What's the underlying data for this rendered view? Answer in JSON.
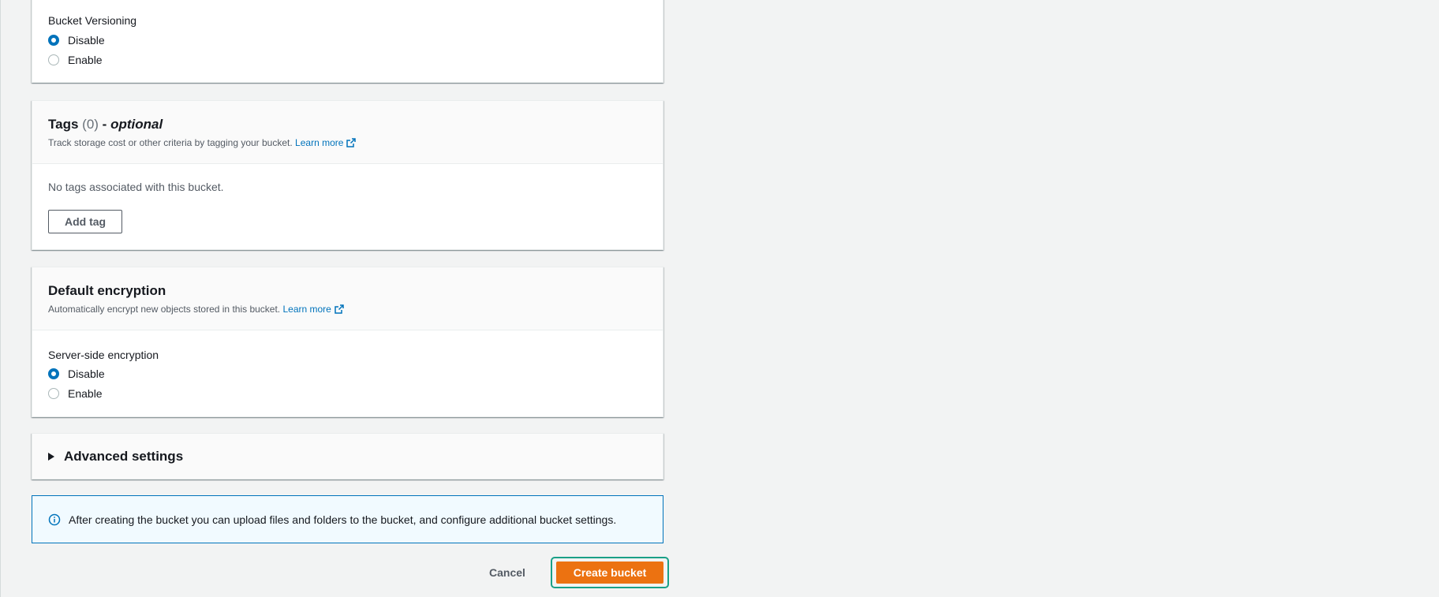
{
  "versioning": {
    "label": "Bucket Versioning",
    "options": [
      "Disable",
      "Enable"
    ],
    "selected": "Disable"
  },
  "tags": {
    "title": "Tags",
    "count": "(0)",
    "dash": "-",
    "optional": "optional",
    "description": "Track storage cost or other criteria by tagging your bucket.",
    "learn_more": "Learn more",
    "empty_text": "No tags associated with this bucket.",
    "add_tag": "Add tag"
  },
  "encryption": {
    "title": "Default encryption",
    "description": "Automatically encrypt new objects stored in this bucket.",
    "learn_more": "Learn more",
    "label": "Server-side encryption",
    "options": [
      "Disable",
      "Enable"
    ],
    "selected": "Disable"
  },
  "advanced": {
    "title": "Advanced settings"
  },
  "info": {
    "text": "After creating the bucket you can upload files and folders to the bucket, and configure additional bucket settings."
  },
  "actions": {
    "cancel": "Cancel",
    "create": "Create bucket"
  },
  "colors": {
    "accent": "#0073bb",
    "primary_button": "#ec7211",
    "focus_ring": "#1aa087"
  },
  "icons": {
    "external_link": "external-link-icon",
    "info": "info-icon",
    "caret": "caret-right-icon"
  }
}
